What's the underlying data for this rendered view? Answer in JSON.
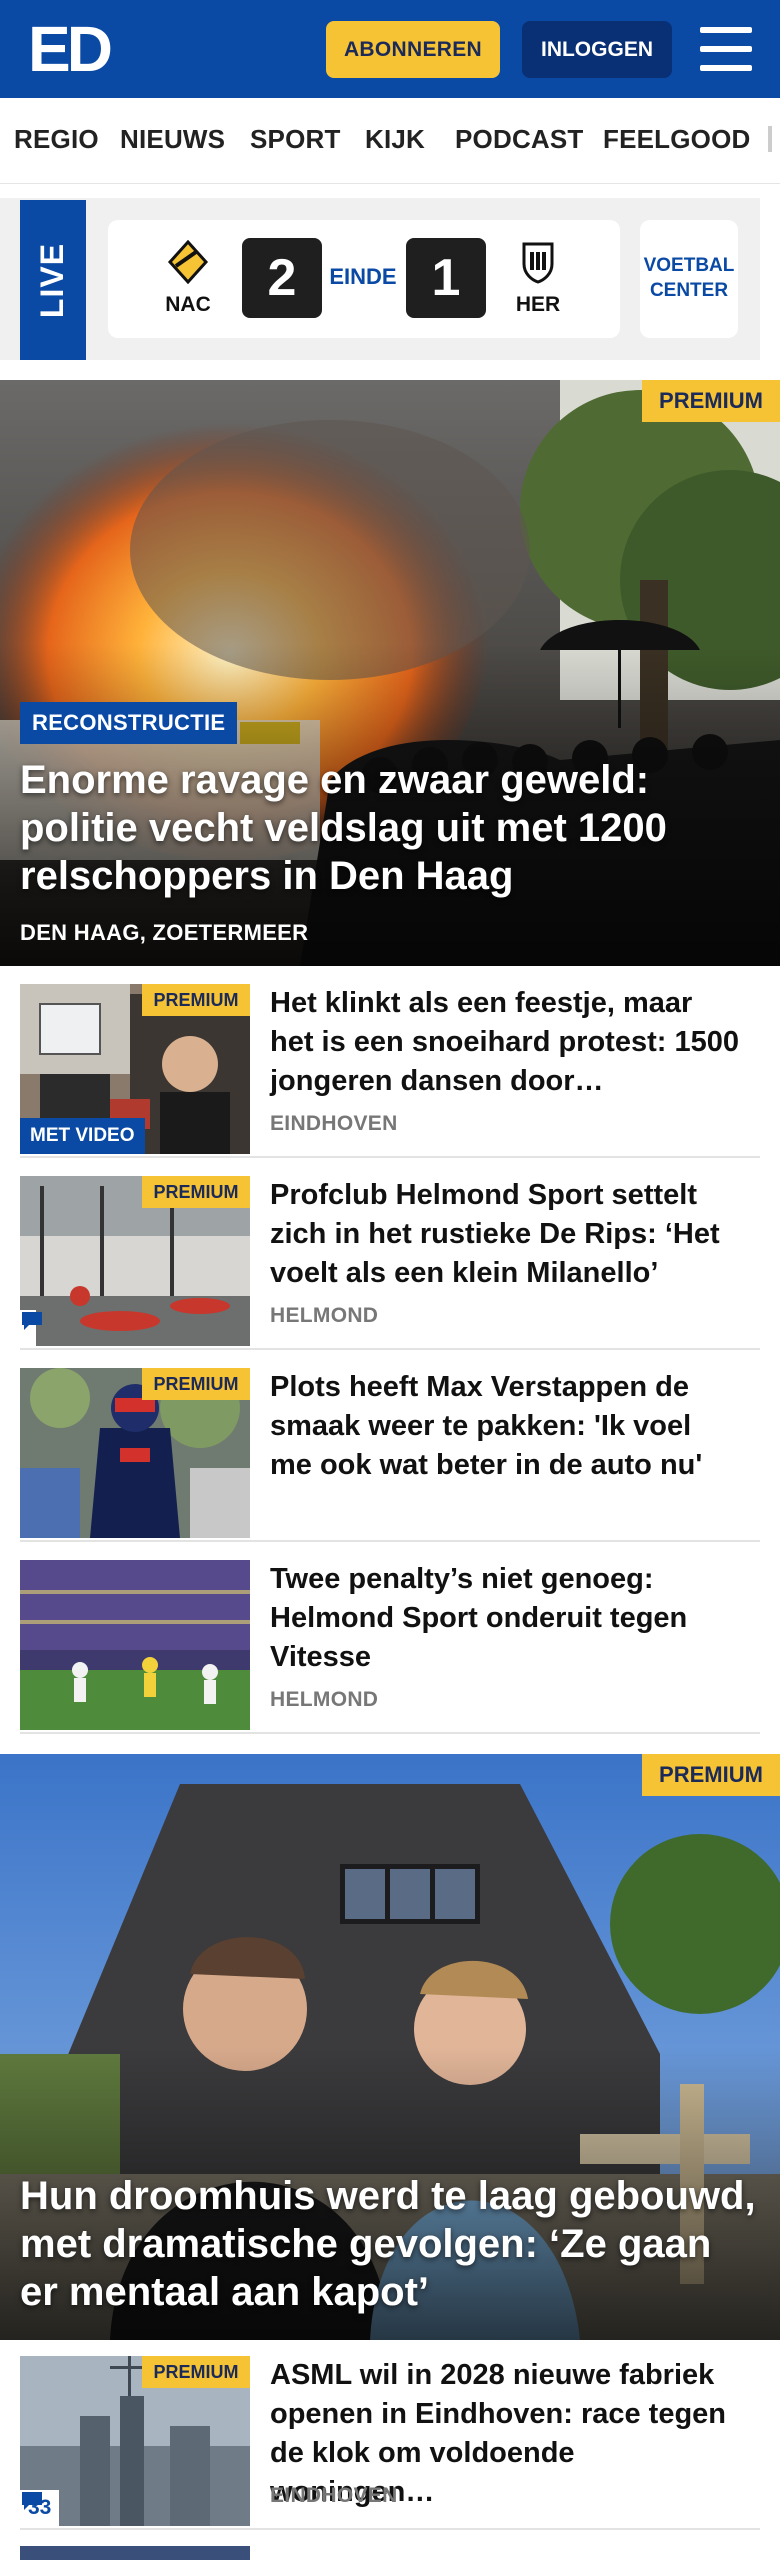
{
  "header": {
    "logo": "ED",
    "subscribe_label": "ABONNEREN",
    "login_label": "INLOGGEN"
  },
  "nav": {
    "items": [
      "REGIO",
      "NIEUWS",
      "SPORT",
      "KIJK",
      "PODCAST",
      "FEELGOOD"
    ]
  },
  "live": {
    "tag": "LIVE",
    "home_team": "NAC",
    "home_score": "2",
    "status": "EINDE",
    "away_score": "1",
    "away_team": "HER",
    "center_line1": "VOETBAL",
    "center_line2": "CENTER"
  },
  "hero1": {
    "premium": "PREMIUM",
    "kicker": "RECONSTRUCTIE",
    "title": "Enorme ravage en zwaar geweld: politie vecht veldslag uit met 1200 relschoppers in Den Haag",
    "location": "DEN HAAG, ZOETERMEER"
  },
  "articles": [
    {
      "premium": "PREMIUM",
      "badge": "MET VIDEO",
      "title": "Het klinkt als een feestje, maar het is een snoeihard protest: 1500 jongeren dansen door…",
      "location": "EINDHOVEN"
    },
    {
      "premium": "PREMIUM",
      "title": "Profclub Helmond Sport settelt zich in het rustieke De Rips: ‘Het voelt als een klein Milanello’",
      "location": "HELMOND"
    },
    {
      "premium": "PREMIUM",
      "title": "Plots heeft Max Verstappen de smaak weer te pakken: 'Ik voel me ook wat beter in de auto nu'"
    },
    {
      "title": "Twee penalty’s niet genoeg: Helmond Sport onderuit tegen Vitesse",
      "location": "HELMOND"
    }
  ],
  "hero2": {
    "premium": "PREMIUM",
    "title": "Hun droomhuis werd te laag gebouwd, met dramatische gevolgen: ‘Ze gaan er mentaal aan kapot’"
  },
  "article5": {
    "premium": "PREMIUM",
    "comments": "33",
    "title": "ASML wil in 2028 nieuwe fabriek openen in Eindhoven: race tegen de klok om voldoende woningen…",
    "location": "EINDHOVEN"
  },
  "colors": {
    "brand_blue": "#0a4aa5",
    "premium_yellow": "#f6c335",
    "dark_navy": "#092f74"
  }
}
